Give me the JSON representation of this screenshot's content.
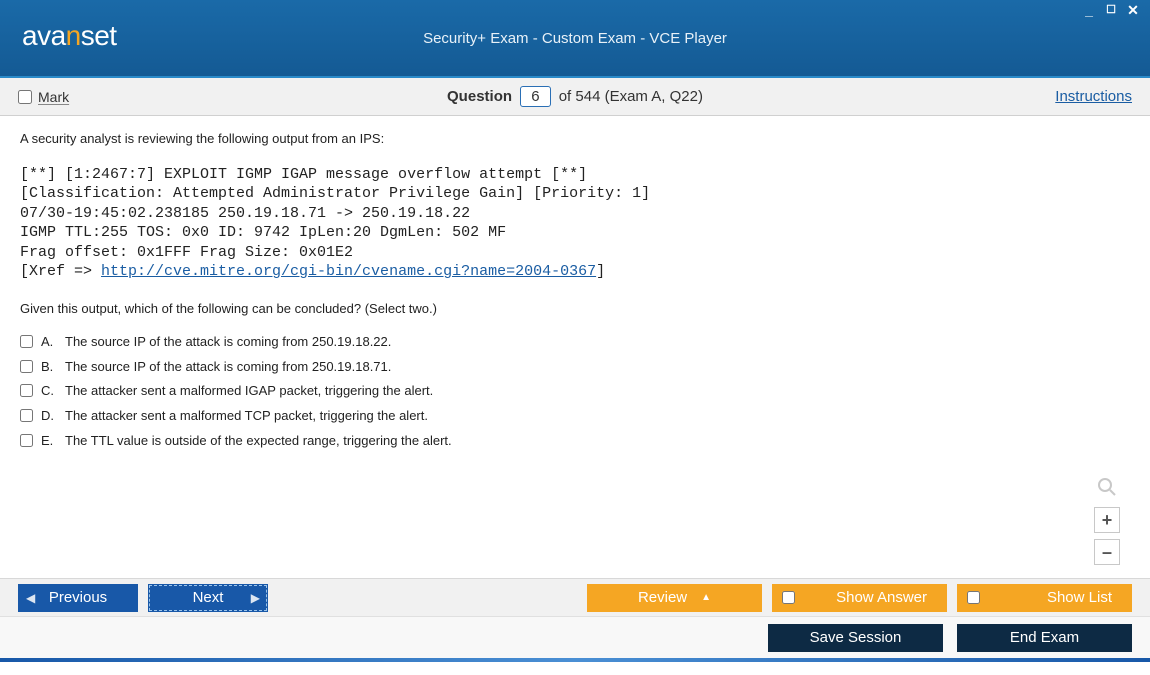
{
  "titlebar": {
    "logo_pre": "ava",
    "logo_n": "n",
    "logo_post": "set",
    "title": "Security+ Exam - Custom Exam - VCE Player"
  },
  "toolbar": {
    "mark_label": "Mark",
    "question_label": "Question",
    "question_number": "6",
    "question_total": "of 544 (Exam A, Q22)",
    "instructions": "Instructions"
  },
  "question": {
    "stem": "A security analyst is reviewing the following output from an IPS:",
    "ips_line1": "[**] [1:2467:7] EXPLOIT IGMP IGAP message overflow attempt [**]",
    "ips_line2": "[Classification: Attempted Administrator Privilege Gain] [Priority: 1]",
    "ips_line3": "07/30-19:45:02.238185 250.19.18.71 -> 250.19.18.22",
    "ips_line4": "IGMP TTL:255 TOS: 0x0 ID: 9742 IpLen:20 DgmLen: 502 MF",
    "ips_line5": "Frag offset: 0x1FFF Frag Size: 0x01E2",
    "ips_line6_pre": "[Xref => ",
    "ips_link": "http://cve.mitre.org/cgi-bin/cvename.cgi?name=2004-0367",
    "ips_line6_post": "]",
    "prompt": "Given this output, which of the following can be concluded? (Select two.)",
    "options": [
      {
        "letter": "A.",
        "text": "The source IP of the attack is coming from 250.19.18.22."
      },
      {
        "letter": "B.",
        "text": "The source IP of the attack is coming from 250.19.18.71."
      },
      {
        "letter": "C.",
        "text": "The attacker sent a malformed IGAP packet, triggering the alert."
      },
      {
        "letter": "D.",
        "text": "The attacker sent a malformed TCP packet, triggering the alert."
      },
      {
        "letter": "E.",
        "text": "The TTL value is outside of the expected range, triggering the alert."
      }
    ]
  },
  "nav": {
    "previous": "Previous",
    "next": "Next",
    "review": "Review",
    "show_answer": "Show Answer",
    "show_list": "Show List"
  },
  "session": {
    "save": "Save Session",
    "end": "End Exam"
  }
}
